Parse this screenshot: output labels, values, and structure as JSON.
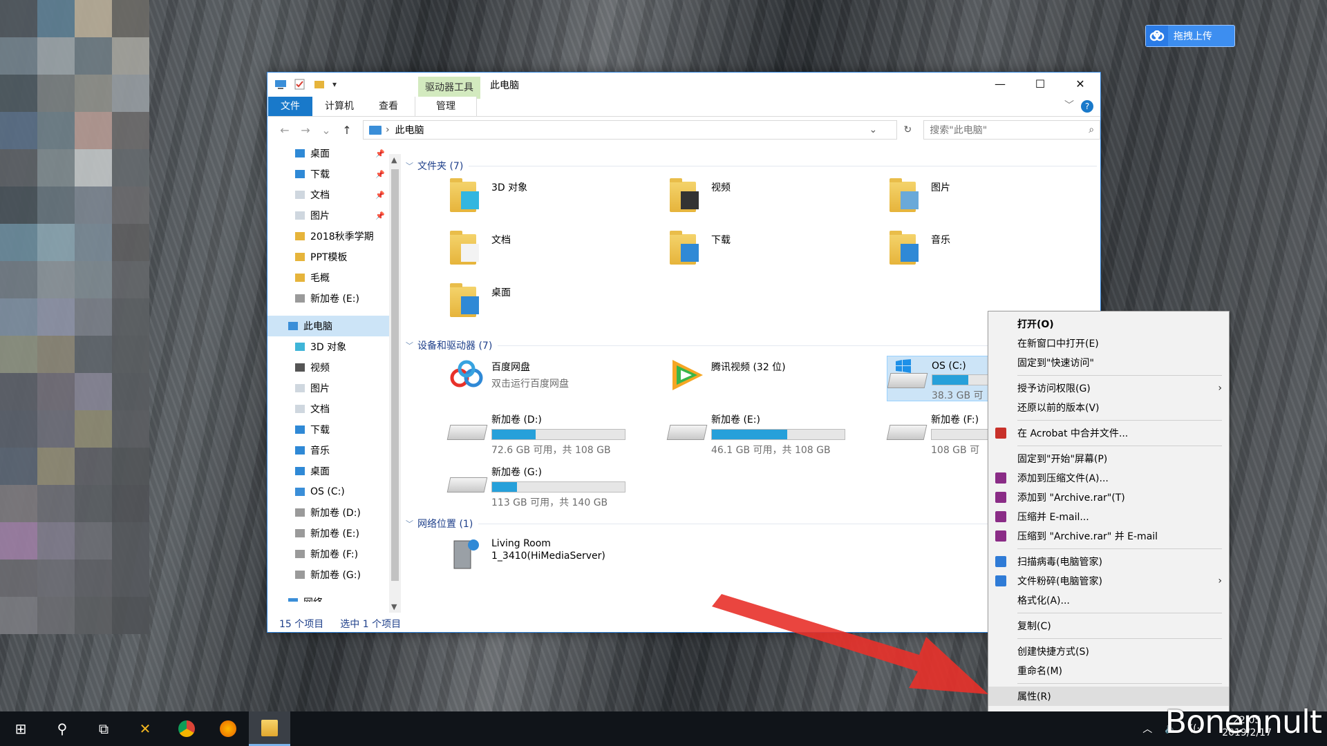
{
  "desktop": {
    "upload_label": "拖拽上传",
    "mosaic_colors": [
      "#51595f",
      "#5e7f93",
      "#b7ad98",
      "#6b6a66",
      "#72818b",
      "#9aa3a7",
      "#6f7c83",
      "#a3a39c",
      "#4e5a61",
      "#7a7f80",
      "#8e8f8a",
      "#959ba0",
      "#5a6f86",
      "#6f7f88",
      "#b39993",
      "#6d6b6b",
      "#5d6266",
      "#7f8a8e",
      "#c0c4c5",
      "#656a6e",
      "#4a545a",
      "#66737c",
      "#7c8590",
      "#6a6a6c",
      "#6a8a9a",
      "#8aa4b0",
      "#7a8a96",
      "#5e5e60",
      "#727c84",
      "#8b949a",
      "#7e8a90",
      "#646669",
      "#7e8ea0",
      "#8d93a6",
      "#7a7f88",
      "#5c5f63",
      "#8c9080",
      "#8a8676",
      "#60666b",
      "#5a5d61",
      "#5c6068",
      "#716e77",
      "#858494",
      "#585b5f",
      "#5a5f6a",
      "#6e6f7a",
      "#8d8a72",
      "#5b5d62",
      "#5b6573",
      "#8e8a74",
      "#5f6166",
      "#535659",
      "#7c787d",
      "#6d6e74",
      "#5b5e63",
      "#505357",
      "#9b7ea3",
      "#7f7c8b",
      "#6c6e74",
      "#55585c",
      "#6a6a70",
      "#6e6f75",
      "#5f6166",
      "#55585c",
      "#7a7b80",
      "#6b6c71",
      "#5c5e62",
      "#4f5256"
    ]
  },
  "window": {
    "qat_dropdown": "▾",
    "context_tab": "驱动器工具",
    "title": "此电脑",
    "controls": {
      "minimize": "—",
      "maximize": "☐",
      "close": "✕"
    },
    "ribbon_tabs": [
      "文件",
      "计算机",
      "查看"
    ],
    "manage_tab": "管理",
    "help": "?",
    "collapse": "﹀",
    "address": "此电脑",
    "address_sep": "›",
    "search_placeholder": "搜索\"此电脑\"",
    "nav_glyphs": {
      "back": "←",
      "forward": "→",
      "recent": "⌄",
      "up": "↑",
      "dropdown": "⌄",
      "refresh": "↻",
      "search": "⌕",
      "pin": "📌",
      "scroll_up": "▲",
      "scroll_down": "▼"
    },
    "status_count": "15 个项目",
    "status_selected": "选中 1 个项目"
  },
  "sidebar": [
    {
      "label": "桌面",
      "pinned": true,
      "color": "#2f89d6"
    },
    {
      "label": "下载",
      "pinned": true,
      "color": "#2f89d6"
    },
    {
      "label": "文档",
      "pinned": true,
      "color": "#cfd7df"
    },
    {
      "label": "图片",
      "pinned": true,
      "color": "#cfd7df"
    },
    {
      "label": "2018秋季学期",
      "pinned": false,
      "color": "#e6b43b"
    },
    {
      "label": "PPT模板",
      "pinned": false,
      "color": "#e6b43b"
    },
    {
      "label": "毛概",
      "pinned": false,
      "color": "#e6b43b"
    },
    {
      "label": "新加卷 (E:)",
      "pinned": false,
      "color": "#9a9a9a"
    },
    {
      "label": "",
      "pinned": false,
      "color": ""
    },
    {
      "label": "此电脑",
      "pinned": false,
      "color": "#3a8ed8",
      "selected": true
    },
    {
      "label": "3D 对象",
      "pinned": false,
      "color": "#3fb5d8"
    },
    {
      "label": "视频",
      "pinned": false,
      "color": "#555"
    },
    {
      "label": "图片",
      "pinned": false,
      "color": "#cfd7df"
    },
    {
      "label": "文档",
      "pinned": false,
      "color": "#cfd7df"
    },
    {
      "label": "下载",
      "pinned": false,
      "color": "#2f89d6"
    },
    {
      "label": "音乐",
      "pinned": false,
      "color": "#2f89d6"
    },
    {
      "label": "桌面",
      "pinned": false,
      "color": "#2f89d6"
    },
    {
      "label": "OS (C:)",
      "pinned": false,
      "color": "#3a8ed8"
    },
    {
      "label": "新加卷 (D:)",
      "pinned": false,
      "color": "#9a9a9a"
    },
    {
      "label": "新加卷 (E:)",
      "pinned": false,
      "color": "#9a9a9a"
    },
    {
      "label": "新加卷 (F:)",
      "pinned": false,
      "color": "#9a9a9a"
    },
    {
      "label": "新加卷 (G:)",
      "pinned": false,
      "color": "#9a9a9a"
    },
    {
      "label": "",
      "pinned": false,
      "color": ""
    },
    {
      "label": "网络",
      "pinned": false,
      "color": "#3a8ed8"
    }
  ],
  "groups": {
    "folders": "文件夹 (7)",
    "devices": "设备和驱动器 (7)",
    "network": "网络位置 (1)",
    "chevron": "﹀"
  },
  "folders": [
    {
      "label": "3D 对象",
      "overlay": "#32b6e0"
    },
    {
      "label": "视频",
      "overlay": "#333"
    },
    {
      "label": "图片",
      "overlay": "#6aa9d9"
    },
    {
      "label": "文档",
      "overlay": "#f3f3f3"
    },
    {
      "label": "下载",
      "overlay": "#2f89d6"
    },
    {
      "label": "音乐",
      "overlay": "#2f89d6"
    },
    {
      "label": "桌面",
      "overlay": "#2f89d6"
    }
  ],
  "devices": [
    {
      "label": "百度网盘",
      "sub": "双击运行百度网盘",
      "type": "app"
    },
    {
      "label": "腾讯视频 (32 位)",
      "sub": "",
      "type": "app2"
    },
    {
      "label": "OS (C:)",
      "sub": "38.3 GB 可",
      "type": "drive",
      "fill": 0.65,
      "selected": true
    },
    {
      "label": "新加卷 (D:)",
      "sub": "72.6 GB 可用，共 108 GB",
      "type": "drive",
      "fill": 0.33
    },
    {
      "label": "新加卷 (E:)",
      "sub": "46.1 GB 可用，共 108 GB",
      "type": "drive",
      "fill": 0.57
    },
    {
      "label": "新加卷 (F:)",
      "sub": "108 GB 可",
      "type": "drive",
      "fill": 0.0
    },
    {
      "label": "新加卷 (G:)",
      "sub": "113 GB 可用，共 140 GB",
      "type": "drive",
      "fill": 0.19
    }
  ],
  "network": [
    {
      "label": "Living Room",
      "sub": "1_3410(HiMediaServer)"
    }
  ],
  "context_menu": [
    {
      "label": "打开(O)",
      "bold": true
    },
    {
      "label": "在新窗口中打开(E)"
    },
    {
      "label": "固定到\"快速访问\""
    },
    {
      "sep": true
    },
    {
      "label": "授予访问权限(G)",
      "submenu": true
    },
    {
      "label": "还原以前的版本(V)"
    },
    {
      "sep": true
    },
    {
      "label": "在 Acrobat 中合并文件...",
      "icon": "#c8312a"
    },
    {
      "sep": true
    },
    {
      "label": "固定到\"开始\"屏幕(P)"
    },
    {
      "label": "添加到压缩文件(A)...",
      "icon": "#8a2c86"
    },
    {
      "label": "添加到 \"Archive.rar\"(T)",
      "icon": "#8a2c86"
    },
    {
      "label": "压缩并 E-mail...",
      "icon": "#8a2c86"
    },
    {
      "label": "压缩到 \"Archive.rar\" 并 E-mail",
      "icon": "#8a2c86"
    },
    {
      "sep": true
    },
    {
      "label": "扫描病毒(电脑管家)",
      "icon": "#2f7bd6"
    },
    {
      "label": "文件粉碎(电脑管家)",
      "icon": "#2f7bd6",
      "submenu": true
    },
    {
      "label": "格式化(A)..."
    },
    {
      "sep": true
    },
    {
      "label": "复制(C)"
    },
    {
      "sep": true
    },
    {
      "label": "创建快捷方式(S)"
    },
    {
      "label": "重命名(M)"
    },
    {
      "sep": true
    },
    {
      "label": "属性(R)",
      "highlight": true
    }
  ],
  "submenu_glyph": "›",
  "taskbar": {
    "icons": [
      "windows-start-icon",
      "search-icon",
      "task-view-icon",
      "xmind-icon",
      "chrome-icon",
      "firefox-icon",
      "file-explorer-icon"
    ],
    "glyphs": {
      "windows-start-icon": "⊞",
      "search-icon": "⚲",
      "task-view-icon": "⧉",
      "xmind-icon": "✕",
      "chrome-icon": "",
      "firefox-icon": "",
      "file-explorer-icon": ""
    },
    "tray_chevron": "︿",
    "tray_volume": "🔈",
    "tray_wifi": "((·",
    "time": "22:05",
    "date": "2019/2/17",
    "watermark": "Bonennult"
  }
}
